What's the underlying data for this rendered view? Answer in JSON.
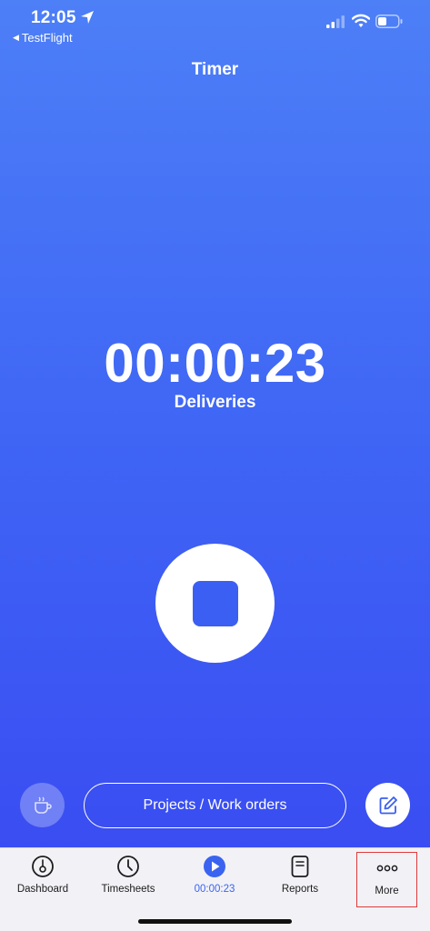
{
  "status_bar": {
    "time": "12:05",
    "back_app": "TestFlight",
    "icons": [
      "location-arrow-icon",
      "signal-icon",
      "wifi-icon",
      "battery-icon"
    ]
  },
  "header": {
    "title": "Timer"
  },
  "timer": {
    "elapsed": "00:00:23",
    "project": "Deliveries"
  },
  "actions": {
    "stop_icon": "stop-icon",
    "break_icon": "coffee-cup-icon",
    "projects_label": "Projects / Work orders",
    "edit_icon": "edit-note-icon"
  },
  "tab_bar": {
    "tabs": [
      {
        "label": "Dashboard",
        "icon": "gauge-icon"
      },
      {
        "label": "Timesheets",
        "icon": "clock-icon"
      },
      {
        "label": "00:00:23",
        "icon": "play-icon",
        "active": true
      },
      {
        "label": "Reports",
        "icon": "document-icon"
      },
      {
        "label": "More",
        "icon": "ellipsis-icon",
        "highlighted": true
      }
    ]
  },
  "colors": {
    "gradient_top": "#4d7ff7",
    "gradient_bottom": "#3a4df2",
    "accent": "#3a64f0",
    "highlight_border": "#e0393a"
  }
}
